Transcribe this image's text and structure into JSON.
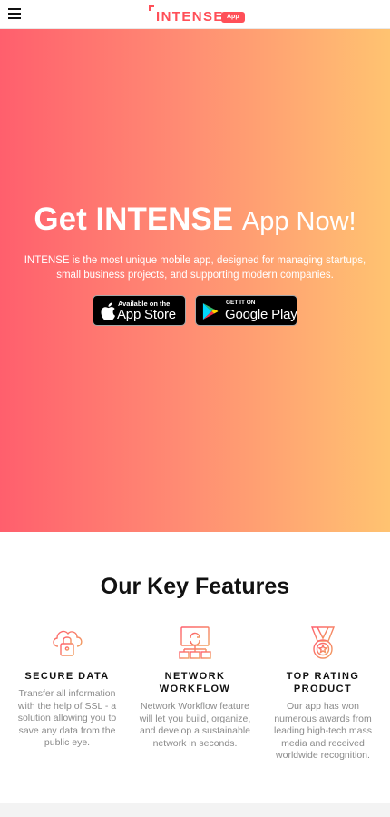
{
  "header": {
    "menu_icon": "hamburger-menu-icon",
    "logo_text": "INTENSE",
    "logo_badge": "App"
  },
  "hero": {
    "title_bold": "Get INTENSE",
    "title_thin": "App Now!",
    "description": "INTENSE is the most unique mobile app, designed for managing startups, small business projects, and supporting modern companies.",
    "app_store": {
      "small": "Available on the",
      "big": "App Store",
      "icon": "apple-icon"
    },
    "google_play": {
      "small": "GET IT ON",
      "big": "Google Play",
      "icon": "google-play-icon"
    },
    "gradient": [
      "#ff5f6d",
      "#ffc371"
    ]
  },
  "features": {
    "title": "Our Key Features",
    "items": [
      {
        "icon": "cloud-lock-icon",
        "title": "SECURE DATA",
        "text": "Transfer all information with the help of SSL - a solution allowing you to save any data from the public eye."
      },
      {
        "icon": "network-workflow-icon",
        "title": "NETWORK WORKFLOW",
        "text": "Network Workflow feature will let you build, organize, and develop a sustainable network in seconds."
      },
      {
        "icon": "award-medal-icon",
        "title": "TOP RATING PRODUCT",
        "text": "Our app has won numerous awards from leading high-tech mass media and received worldwide recognition."
      }
    ]
  },
  "colors": {
    "accent": "#ff4f58",
    "icon_gradient_start": "#ff5f6d",
    "icon_gradient_end": "#f0a060"
  }
}
